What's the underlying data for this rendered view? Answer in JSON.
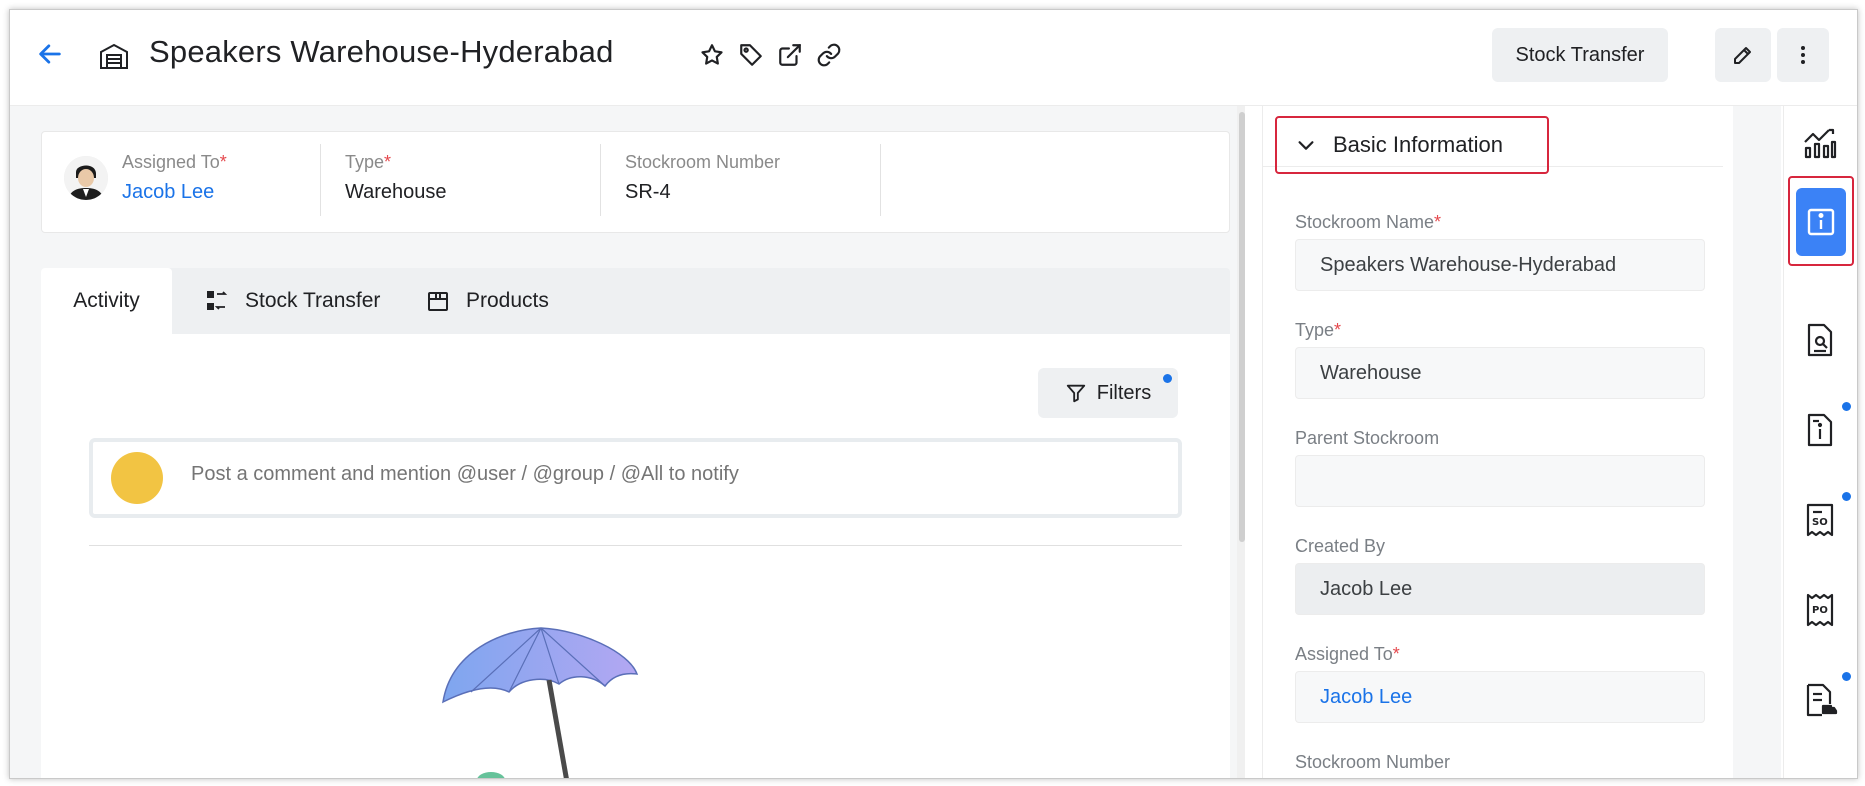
{
  "header": {
    "title": "Speakers Warehouse-Hyderabad",
    "stock_transfer_button": "Stock Transfer",
    "icons": [
      "back-arrow-icon",
      "warehouse-icon",
      "star-icon",
      "tag-icon",
      "external-link-icon",
      "link-icon",
      "edit-pencil-icon",
      "more-vertical-icon"
    ]
  },
  "summary": {
    "assigned_to_label": "Assigned To",
    "assigned_to_value": "Jacob Lee",
    "type_label": "Type",
    "type_value": "Warehouse",
    "stockroom_number_label": "Stockroom Number",
    "stockroom_number_value": "SR-4",
    "required_mark": "*"
  },
  "tabs": [
    {
      "label": "Activity",
      "active": true
    },
    {
      "label": "Stock Transfer",
      "active": false
    },
    {
      "label": "Products",
      "active": false
    }
  ],
  "activity": {
    "filters_label": "Filters",
    "comment_placeholder": "Post a comment and mention @user / @group / @All to notify"
  },
  "basic_info": {
    "section_title": "Basic Information",
    "required_mark": "*",
    "fields": [
      {
        "label": "Stockroom Name",
        "value": "Speakers Warehouse-Hyderabad",
        "required": true
      },
      {
        "label": "Type",
        "value": "Warehouse",
        "required": true
      },
      {
        "label": "Parent Stockroom",
        "value": "",
        "required": false
      },
      {
        "label": "Created By",
        "value": "Jacob Lee",
        "required": false
      },
      {
        "label": "Assigned To",
        "value": "Jacob Lee",
        "required": true
      },
      {
        "label": "Stockroom Number",
        "value": "",
        "required": false
      }
    ]
  },
  "side_strip": {
    "icons": [
      "analytics-chart-icon",
      "info-icon",
      "document-search-icon",
      "document-info-icon",
      "sales-order-icon",
      "purchase-order-icon",
      "invoice-delivery-icon"
    ],
    "so_label": "SO",
    "po_label": "PO"
  },
  "colors": {
    "accent": "#1a73e8",
    "active_strip": "#3b82f6",
    "highlight_border": "#d7263d",
    "required": "#e5484d"
  }
}
